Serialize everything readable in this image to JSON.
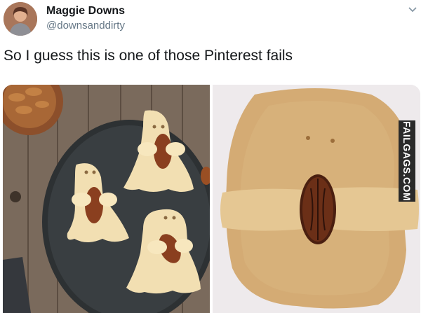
{
  "tweet": {
    "author_name": "Maggie Downs",
    "author_handle": "@downsanddirty",
    "text": "So I guess this is one of those Pinterest fails"
  },
  "media": {
    "watermark_text": "FAILGAGS.COM"
  },
  "colors": {
    "handle_gray": "#657786",
    "text_dark": "#14171a"
  },
  "icons": [
    "avatar",
    "chevron-down-icon"
  ]
}
